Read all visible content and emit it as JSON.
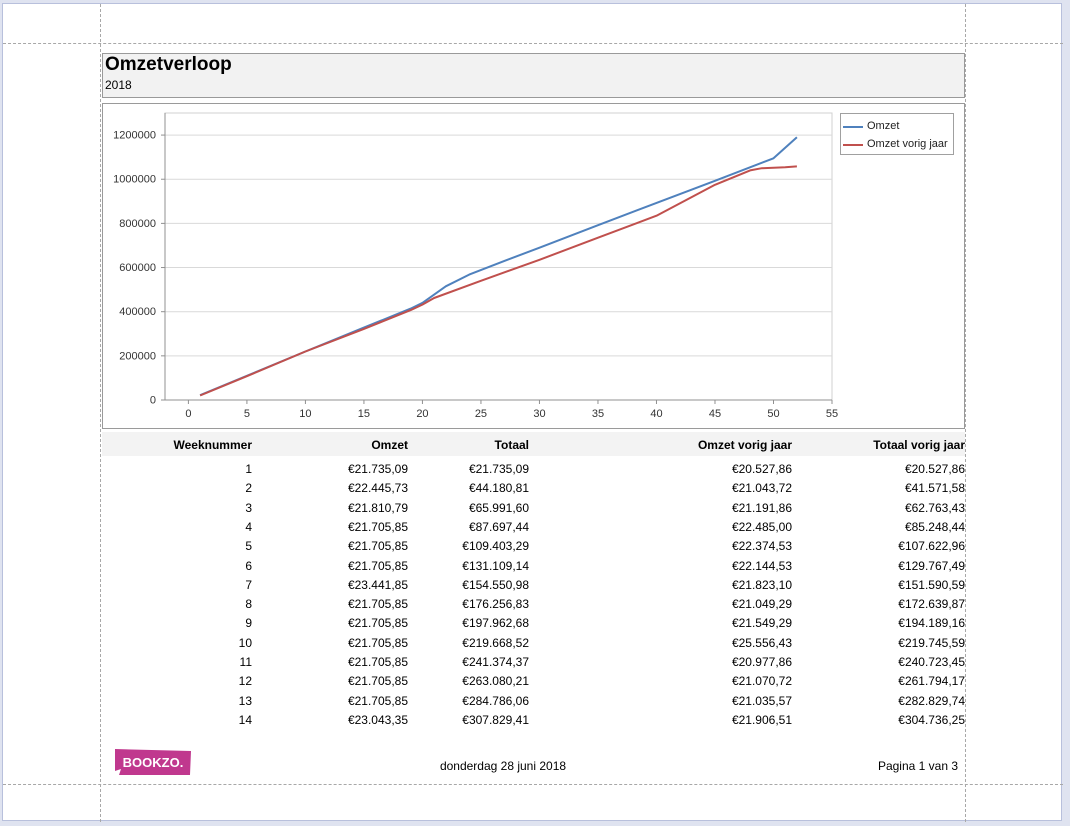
{
  "report": {
    "title": "Omzetverloop",
    "subtitle": "2018"
  },
  "colors": {
    "omzet": "#4f81bd",
    "omzet_vorig_jaar": "#c0504d",
    "logo": "#c0388e"
  },
  "chart_data": {
    "type": "line",
    "x_ticks": [
      0,
      5,
      10,
      15,
      20,
      25,
      30,
      35,
      40,
      45,
      50,
      55
    ],
    "y_ticks": [
      0,
      200000,
      400000,
      600000,
      800000,
      1000000,
      1200000
    ],
    "xlim": [
      -2,
      55
    ],
    "ylim": [
      0,
      1300000
    ],
    "grid": "horizontal",
    "legend_position": "right",
    "series": [
      {
        "name": "Omzet",
        "color": "#4f81bd",
        "points": [
          [
            1,
            21735
          ],
          [
            5,
            109403
          ],
          [
            10,
            219669
          ],
          [
            15,
            328000
          ],
          [
            19,
            414000
          ],
          [
            20,
            440000
          ],
          [
            22,
            515000
          ],
          [
            24,
            568000
          ],
          [
            27,
            630000
          ],
          [
            30,
            690000
          ],
          [
            35,
            792000
          ],
          [
            40,
            893000
          ],
          [
            45,
            993000
          ],
          [
            50,
            1095000
          ],
          [
            52,
            1190000
          ]
        ]
      },
      {
        "name": "Omzet vorig jaar",
        "color": "#c0504d",
        "points": [
          [
            1,
            20528
          ],
          [
            5,
            107623
          ],
          [
            10,
            219746
          ],
          [
            15,
            322000
          ],
          [
            19,
            407000
          ],
          [
            20,
            432000
          ],
          [
            21,
            462000
          ],
          [
            25,
            540000
          ],
          [
            30,
            635000
          ],
          [
            35,
            735000
          ],
          [
            40,
            835000
          ],
          [
            45,
            975000
          ],
          [
            48,
            1040000
          ],
          [
            49,
            1050000
          ],
          [
            51,
            1054000
          ],
          [
            52,
            1058000
          ]
        ]
      }
    ]
  },
  "table": {
    "headers": [
      "Weeknummer",
      "Omzet",
      "Totaal",
      "Omzet vorig jaar",
      "Totaal vorig jaar"
    ],
    "rows": [
      [
        "1",
        "€21.735,09",
        "€21.735,09",
        "€20.527,86",
        "€20.527,86"
      ],
      [
        "2",
        "€22.445,73",
        "€44.180,81",
        "€21.043,72",
        "€41.571,58"
      ],
      [
        "3",
        "€21.810,79",
        "€65.991,60",
        "€21.191,86",
        "€62.763,43"
      ],
      [
        "4",
        "€21.705,85",
        "€87.697,44",
        "€22.485,00",
        "€85.248,44"
      ],
      [
        "5",
        "€21.705,85",
        "€109.403,29",
        "€22.374,53",
        "€107.622,96"
      ],
      [
        "6",
        "€21.705,85",
        "€131.109,14",
        "€22.144,53",
        "€129.767,49"
      ],
      [
        "7",
        "€23.441,85",
        "€154.550,98",
        "€21.823,10",
        "€151.590,59"
      ],
      [
        "8",
        "€21.705,85",
        "€176.256,83",
        "€21.049,29",
        "€172.639,87"
      ],
      [
        "9",
        "€21.705,85",
        "€197.962,68",
        "€21.549,29",
        "€194.189,16"
      ],
      [
        "10",
        "€21.705,85",
        "€219.668,52",
        "€25.556,43",
        "€219.745,59"
      ],
      [
        "11",
        "€21.705,85",
        "€241.374,37",
        "€20.977,86",
        "€240.723,45"
      ],
      [
        "12",
        "€21.705,85",
        "€263.080,21",
        "€21.070,72",
        "€261.794,17"
      ],
      [
        "13",
        "€21.705,85",
        "€284.786,06",
        "€21.035,57",
        "€282.829,74"
      ],
      [
        "14",
        "€23.043,35",
        "€307.829,41",
        "€21.906,51",
        "€304.736,25"
      ]
    ]
  },
  "footer": {
    "logo_text": "BOOKZO.",
    "date": "donderdag 28 juni 2018",
    "page": "Pagina 1 van 3"
  }
}
